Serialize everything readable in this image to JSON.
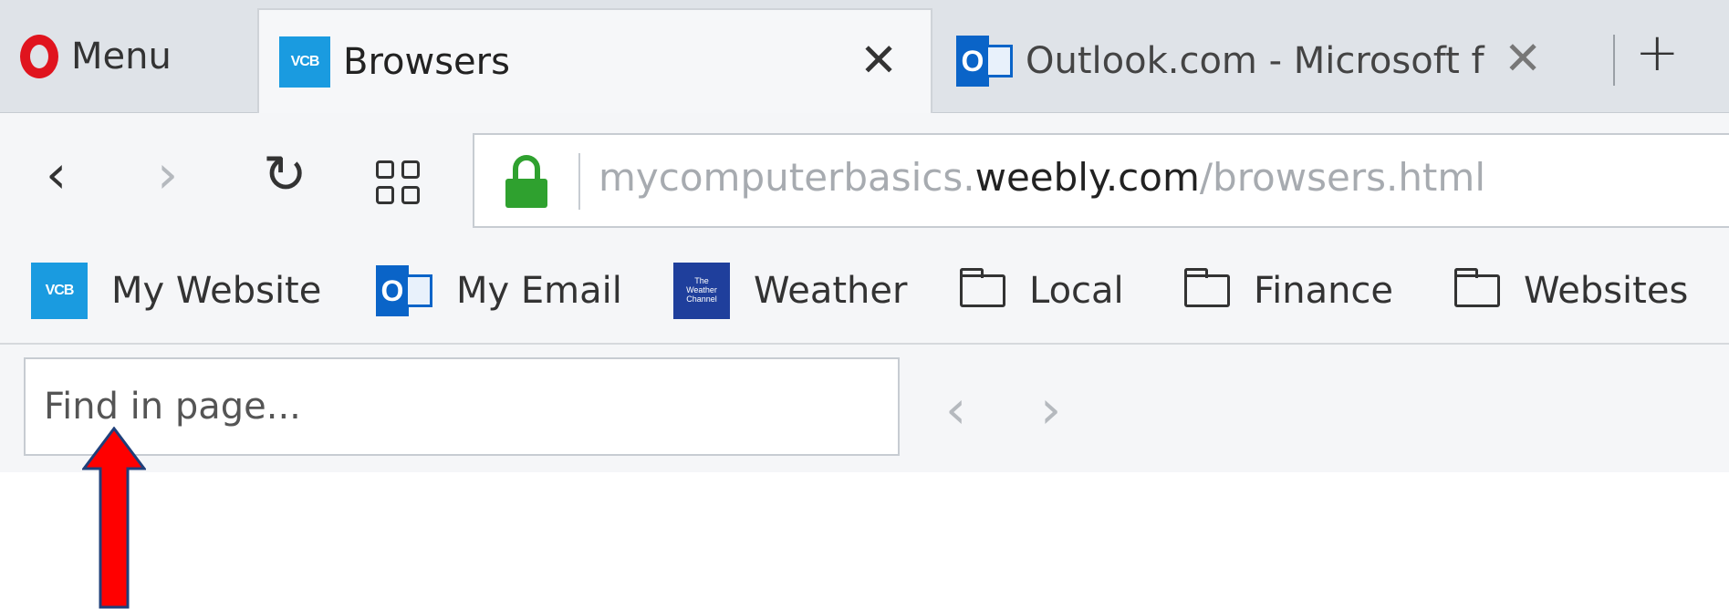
{
  "tabbar": {
    "menu_label": "Menu",
    "tabs": [
      {
        "title": "Browsers",
        "favicon": "vcb-icon",
        "active": true
      },
      {
        "title": "Outlook.com - Microsoft f",
        "favicon": "outlook-icon",
        "active": false
      }
    ],
    "new_tab_label": "+"
  },
  "navbar": {
    "url_prefix": "mycomputerbasics.",
    "url_domain": "weebly.com",
    "url_path": "/browsers.html"
  },
  "bookmarks": [
    {
      "label": "My Website",
      "icon": "vcb-icon"
    },
    {
      "label": "My Email",
      "icon": "outlook-icon"
    },
    {
      "label": "Weather",
      "icon": "weather-channel-icon"
    },
    {
      "label": "Local",
      "icon": "folder-icon"
    },
    {
      "label": "Finance",
      "icon": "folder-icon"
    },
    {
      "label": "Websites",
      "icon": "folder-icon"
    }
  ],
  "findbar": {
    "placeholder": "Find in page..."
  },
  "colors": {
    "opera_red": "#e0141e",
    "lock_green": "#2fa12f",
    "annotation_arrow": "#ff0000"
  }
}
